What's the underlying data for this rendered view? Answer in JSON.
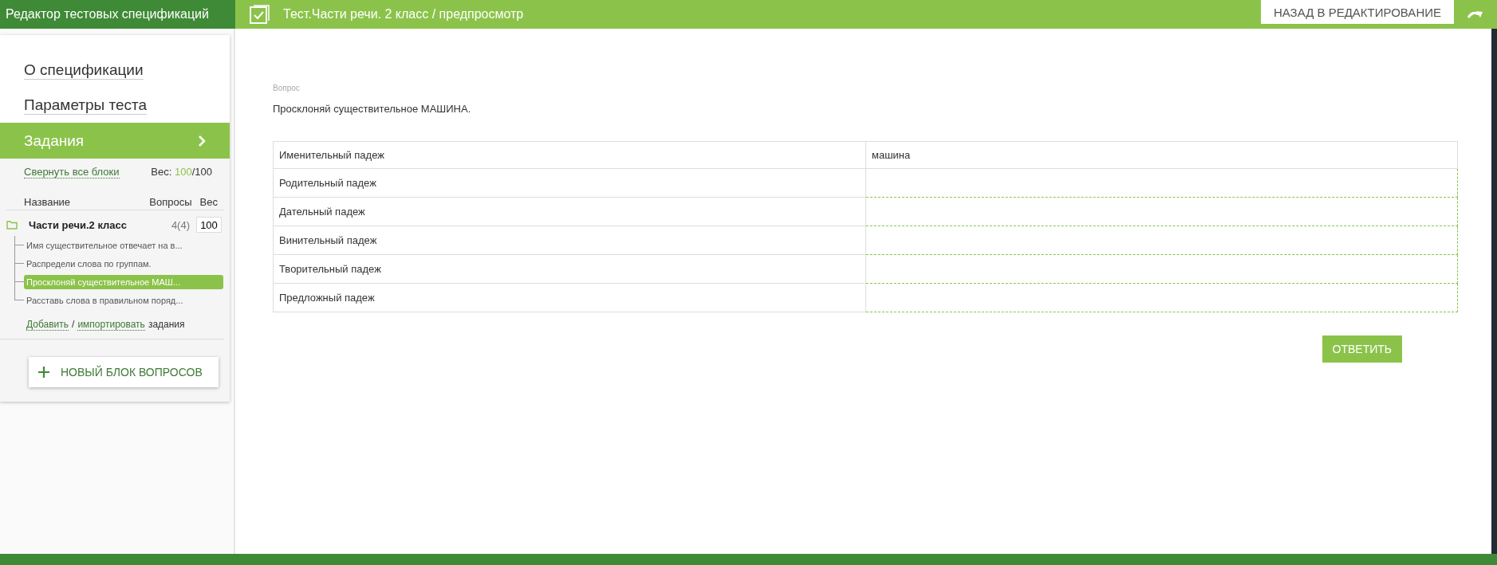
{
  "app_title": "Редактор тестовых спецификаций",
  "header": {
    "title": "Тест.Части речи. 2 класс / предпросмотр",
    "back_button": "НАЗАД В РЕДАКТИРОВАНИЕ"
  },
  "sidebar": {
    "nav": [
      {
        "label": "О спецификации",
        "selected": false
      },
      {
        "label": "Параметры теста",
        "selected": false
      },
      {
        "label": "Задания",
        "selected": true
      }
    ],
    "collapse_link": "Свернуть все блоки",
    "weight_label": "Вес:",
    "weight_value": "100",
    "weight_total": "/100",
    "columns": [
      "Название",
      "Вопросы",
      "Вес"
    ],
    "block": {
      "name": "Части речи.2 класс",
      "count": "4(4)",
      "weight": "100",
      "children": [
        {
          "label": "Имя существительное отвечает на в...",
          "selected": false
        },
        {
          "label": "Распредели слова по группам.",
          "selected": false
        },
        {
          "label": "Просклоняй существительное МАШ...",
          "selected": true
        },
        {
          "label": "Расставь слова в правильном поряд...",
          "selected": false
        }
      ]
    },
    "add_link": "Добавить",
    "separator": "/",
    "import_link": "импортировать",
    "add_suffix": "задания",
    "new_block_button": "НОВЫЙ БЛОК ВОПРОСОВ"
  },
  "question": {
    "label": "Вопрос",
    "text": "Просклоняй существительное МАШИНА.",
    "rows": [
      {
        "case": "Именительный падеж",
        "kind": "given",
        "answer": "машина"
      },
      {
        "case": "Родительный падеж",
        "kind": "input"
      },
      {
        "case": "Дательный падеж",
        "kind": "input"
      },
      {
        "case": "Винительный падеж",
        "kind": "input"
      },
      {
        "case": "Творительный падеж",
        "kind": "input"
      },
      {
        "case": "Предложный падеж",
        "kind": "input"
      }
    ],
    "submit_button": "ОТВЕТИТЬ"
  }
}
